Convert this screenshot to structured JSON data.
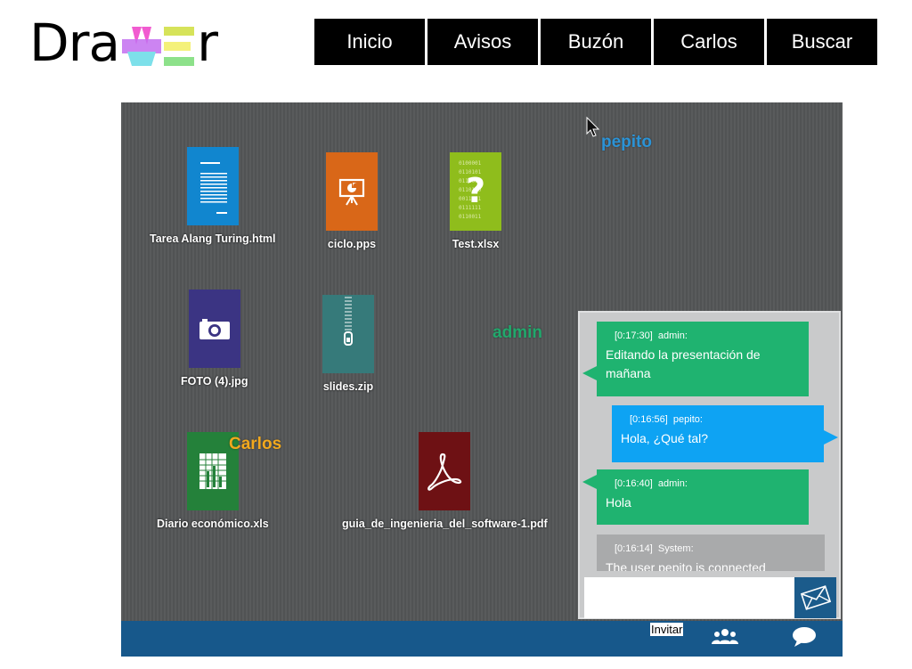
{
  "app": {
    "logo": "Drawer"
  },
  "nav": [
    {
      "label": "Inicio"
    },
    {
      "label": "Avisos"
    },
    {
      "label": "Buzón"
    },
    {
      "label": "Carlos"
    },
    {
      "label": "Buscar"
    }
  ],
  "files": [
    {
      "name": "Tarea Alang Turing.html",
      "icon": "document-icon",
      "color": "#1186cf"
    },
    {
      "name": "ciclo.pps",
      "icon": "presentation-icon",
      "color": "#d96718"
    },
    {
      "name": "Test.xlsx",
      "icon": "unknown-file-icon",
      "color": "#8fbd1c"
    },
    {
      "name": "FOTO (4).jpg",
      "icon": "camera-icon",
      "color": "#3b3483"
    },
    {
      "name": "slides.zip",
      "icon": "zipper-icon",
      "color": "#367a7a"
    },
    {
      "name": "Diario económico.xls",
      "icon": "spreadsheet-icon",
      "color": "#24813a"
    },
    {
      "name": "guia_de_ingenieria_del_software-1.pdf",
      "icon": "pdf-icon",
      "color": "#6e1114"
    }
  ],
  "cursors": [
    {
      "user": "pepito",
      "color": "#2b93d6"
    },
    {
      "user": "admin",
      "color": "#21a86c"
    },
    {
      "user": "Carlos",
      "color": "#f2a81d"
    }
  ],
  "chat": {
    "messages": [
      {
        "time": "[0:17:30]",
        "author": "admin:",
        "text": "Editando la presentación de mañana",
        "color": "#1fb370"
      },
      {
        "time": "[0:16:56]",
        "author": "pepito:",
        "text": "Hola, ¿Qué tal?",
        "color": "#0ea3f3"
      },
      {
        "time": "[0:16:40]",
        "author": "admin:",
        "text": "Hola",
        "color": "#1fb370"
      },
      {
        "time": "[0:16:14]",
        "author": "System:",
        "text": "The user pepito is connected",
        "color": "#a9aaab"
      }
    ],
    "input_value": "",
    "send_icon": "envelope-icon"
  },
  "bottom_bar": {
    "invite_label": "Invitar",
    "users_icon": "users-icon",
    "chat_icon": "chat-bubble-icon",
    "color": "#17588b"
  }
}
